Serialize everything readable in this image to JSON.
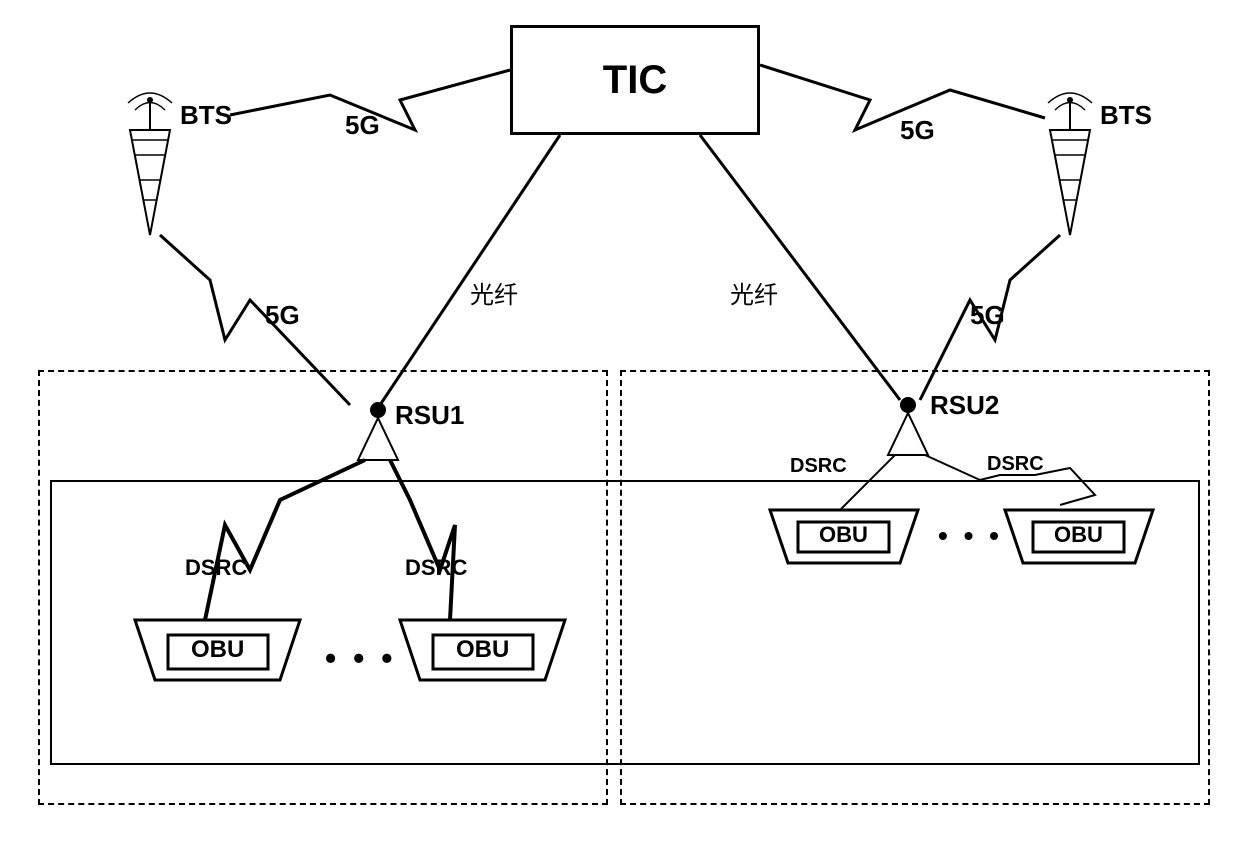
{
  "tic": {
    "label": "TIC"
  },
  "bts": {
    "label_left": "BTS",
    "label_right": "BTS"
  },
  "link_labels": {
    "five_g_top_left": "5G",
    "five_g_top_right": "5G",
    "five_g_mid_left": "5G",
    "five_g_mid_right": "5G",
    "fiber_left": "光纤",
    "fiber_right": "光纤",
    "dsrc_left_1": "DSRC",
    "dsrc_left_2": "DSRC",
    "dsrc_right_1": "DSRC",
    "dsrc_right_2": "DSRC"
  },
  "rsu": {
    "label_1": "RSU1",
    "label_2": "RSU2"
  },
  "obu": {
    "label": "OBU"
  },
  "dots": "• • •"
}
